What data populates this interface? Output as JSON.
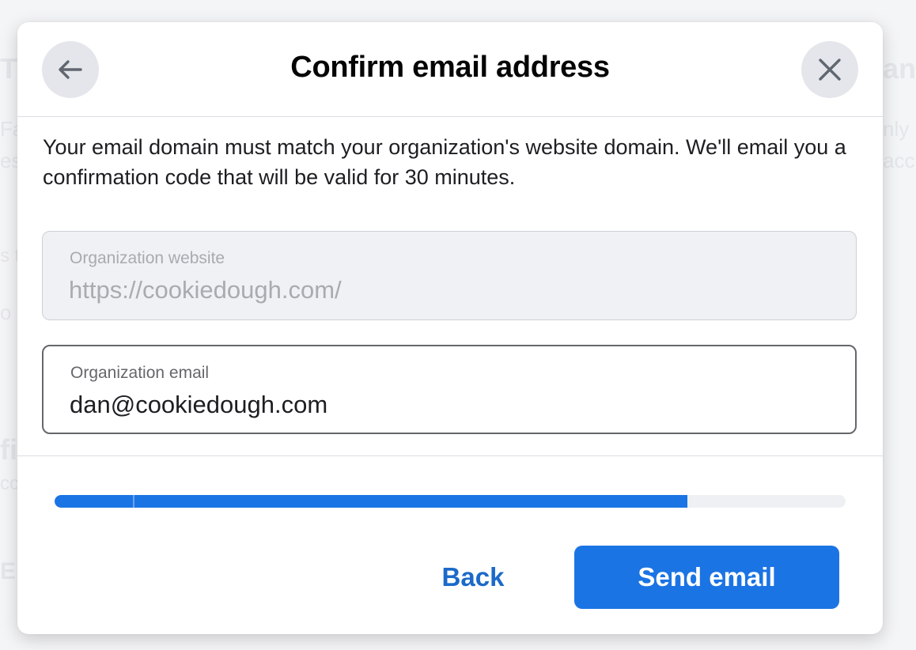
{
  "background": {
    "left_fragments": [
      "T",
      "Fa",
      "es",
      "s t",
      "o",
      "fi",
      "cc",
      "El"
    ],
    "right_fragments": [
      "anc",
      "nly",
      "acc"
    ]
  },
  "dialog": {
    "title": "Confirm email address",
    "description": "Your email domain must match your organization's website domain. We'll email you a confirmation code that will be valid for 30 minutes.",
    "website_field": {
      "label": "Organization website",
      "value": "https://cookiedough.com/"
    },
    "email_field": {
      "label": "Organization email",
      "value": "dan@cookiedough.com"
    },
    "progress": {
      "fraction": 0.8
    },
    "buttons": {
      "back_label": "Back",
      "send_label": "Send email"
    },
    "icons": {
      "back": "arrow-left-icon",
      "close": "close-icon"
    }
  },
  "colors": {
    "accent": "#1b74e4",
    "link": "#1b6ac9",
    "title": "#050505"
  }
}
